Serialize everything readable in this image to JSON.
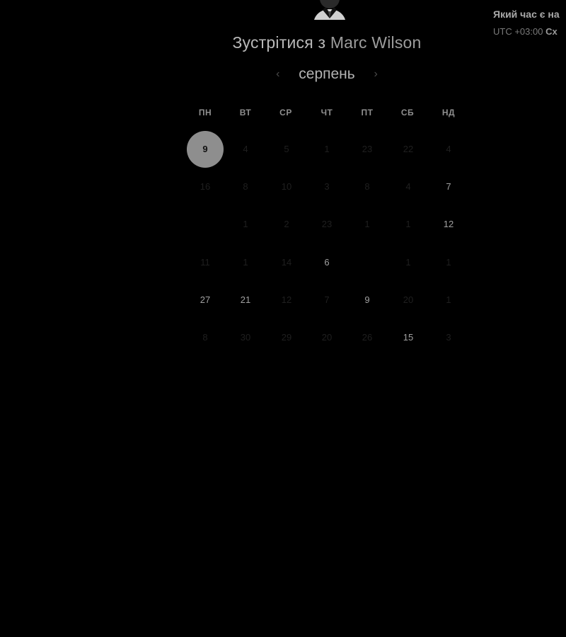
{
  "header": {
    "title_prefix": "Зустрітися з",
    "host_name": "Marc Wilson",
    "avatar_icon": "person-avatar-icon"
  },
  "month_nav": {
    "month": "серпень",
    "prev_icon": "chevron-left-icon",
    "next_icon": "chevron-right-icon"
  },
  "timezone": {
    "question": "Який час є на",
    "value": "UTC +03:00",
    "region": "Сх"
  },
  "weekdays": [
    "ПН",
    "ВТ",
    "СР",
    "ЧТ",
    "ПТ",
    "СБ",
    "НД"
  ],
  "weeks": [
    [
      {
        "label": "9",
        "state": "selected"
      },
      {
        "label": "4",
        "state": "dim"
      },
      {
        "label": "5",
        "state": "dim"
      },
      {
        "label": "1",
        "state": "dim"
      },
      {
        "label": "23",
        "state": "dim"
      },
      {
        "label": "22",
        "state": "dim"
      },
      {
        "label": "4",
        "state": "dim"
      }
    ],
    [
      {
        "label": "16",
        "state": "dim"
      },
      {
        "label": "8",
        "state": "dim"
      },
      {
        "label": "10",
        "state": "dim"
      },
      {
        "label": "3",
        "state": "dim"
      },
      {
        "label": "8",
        "state": "dim"
      },
      {
        "label": "4",
        "state": "dim"
      },
      {
        "label": "7",
        "state": "available"
      }
    ],
    [
      {
        "label": "",
        "state": "dim"
      },
      {
        "label": "1",
        "state": "dim"
      },
      {
        "label": "2",
        "state": "dim"
      },
      {
        "label": "23",
        "state": "dim"
      },
      {
        "label": "1",
        "state": "dim"
      },
      {
        "label": "1",
        "state": "dim"
      },
      {
        "label": "12",
        "state": "available"
      }
    ],
    [
      {
        "label": "11",
        "state": "dim"
      },
      {
        "label": "1",
        "state": "dim"
      },
      {
        "label": "14",
        "state": "dim"
      },
      {
        "label": "6",
        "state": "available"
      },
      {
        "label": "",
        "state": "dim"
      },
      {
        "label": "1",
        "state": "dim"
      },
      {
        "label": "1",
        "state": "dim"
      }
    ],
    [
      {
        "label": "27",
        "state": "available"
      },
      {
        "label": "21",
        "state": "available"
      },
      {
        "label": "12",
        "state": "dim"
      },
      {
        "label": "7",
        "state": "dim"
      },
      {
        "label": "9",
        "state": "available"
      },
      {
        "label": "20",
        "state": "dim"
      },
      {
        "label": "1",
        "state": "dim"
      }
    ],
    [
      {
        "label": "8",
        "state": "dim"
      },
      {
        "label": "30",
        "state": "dim"
      },
      {
        "label": "29",
        "state": "dim"
      },
      {
        "label": "20",
        "state": "dim"
      },
      {
        "label": "26",
        "state": "dim"
      },
      {
        "label": "15",
        "state": "available"
      },
      {
        "label": "3",
        "state": "dim"
      }
    ]
  ]
}
